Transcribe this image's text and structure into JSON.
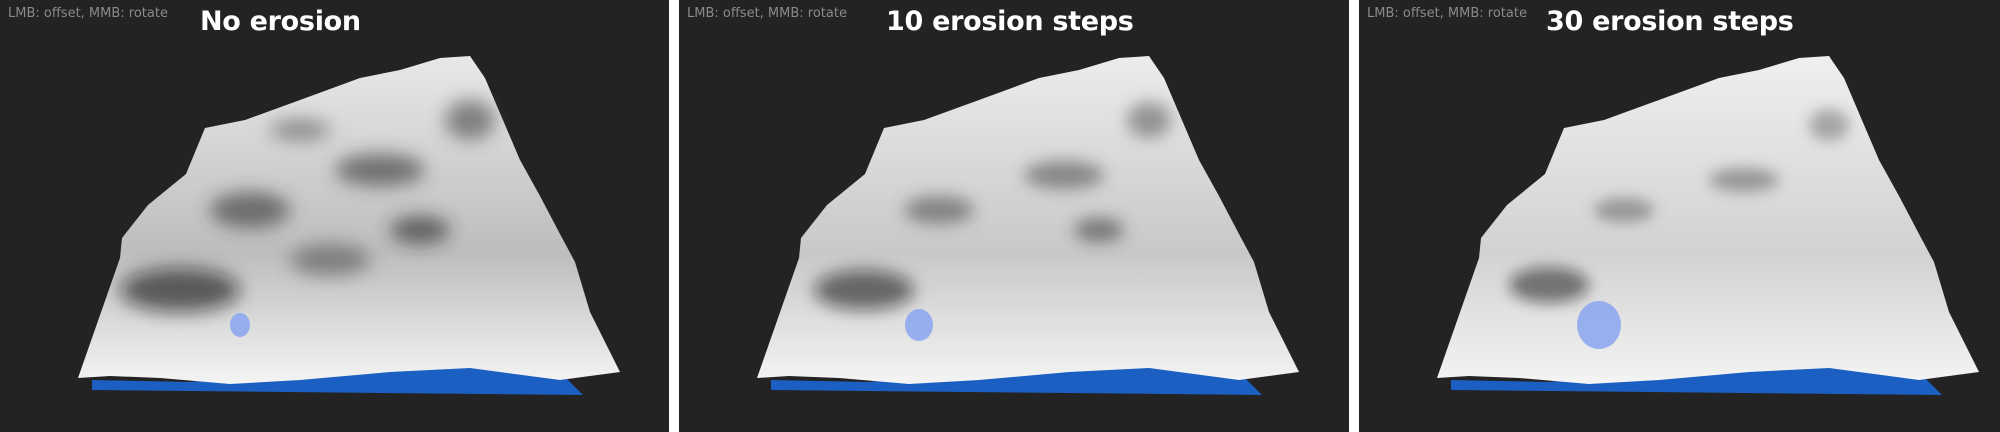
{
  "panels": [
    {
      "hint": "LMB: offset, MMB: rotate",
      "title": "No erosion"
    },
    {
      "hint": "LMB: offset, MMB: rotate",
      "title": "10 erosion steps"
    },
    {
      "hint": "LMB: offset, MMB: rotate",
      "title": "30 erosion steps"
    }
  ],
  "colors": {
    "background": "#232323",
    "separator": "#ffffff",
    "water": "#1b5fc2",
    "pond": "#8fa8f0",
    "terrain_light": "#f2f2f2",
    "terrain_dark": "#1a1a1a"
  }
}
